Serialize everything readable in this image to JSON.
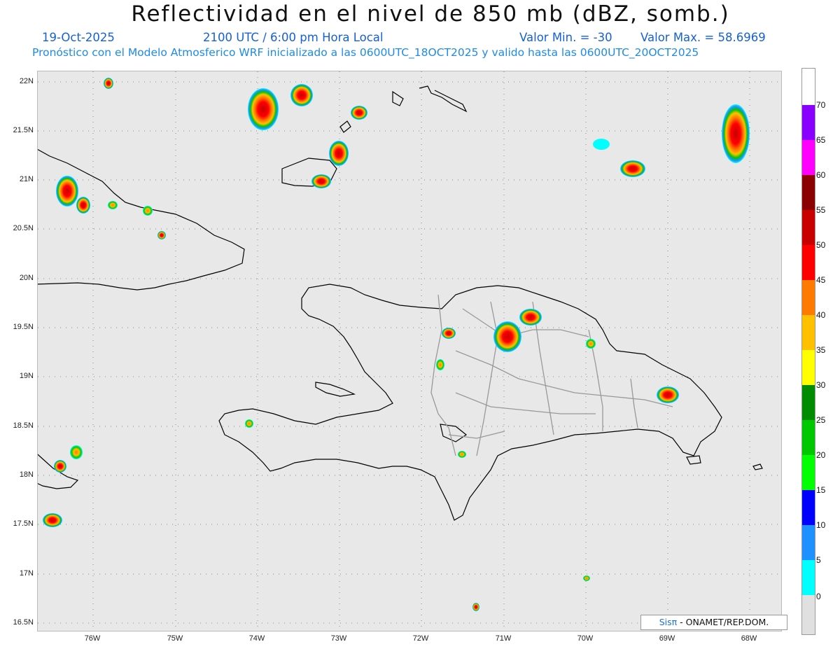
{
  "header": {
    "title": "Reflectividad en el nivel de 850 mb (dBZ, somb.)",
    "date": "19-Oct-2025",
    "time": "2100 UTC / 6:00 pm Hora Local",
    "valmin": "Valor Min. = -30",
    "valmax": "Valor Max. = 58.6969",
    "model_line": "Pronóstico con el Modelo Atmosferico WRF inicializado a las 0600UTC_18OCT2025 y valido hasta las  0600UTC_20OCT2025"
  },
  "axes": {
    "y_labels": [
      "22N",
      "21.5N",
      "21N",
      "20.5N",
      "20N",
      "19.5N",
      "19N",
      "18.5N",
      "18N",
      "17.5N",
      "17N",
      "16.5N"
    ],
    "x_labels": [
      "76W",
      "75W",
      "74W",
      "73W",
      "72W",
      "71W",
      "70W",
      "69W",
      "68W"
    ]
  },
  "colorbar": {
    "labels": [
      "70",
      "65",
      "60",
      "55",
      "50",
      "45",
      "40",
      "35",
      "30",
      "25",
      "20",
      "15",
      "10",
      "5",
      "0"
    ],
    "colors": [
      "#ffffff",
      "#8a00ff",
      "#ff00ff",
      "#8b0000",
      "#c80000",
      "#ff0000",
      "#ff7a00",
      "#ffc000",
      "#ffff00",
      "#008c00",
      "#00c800",
      "#00ff00",
      "#0000ff",
      "#1e90ff",
      "#00ffff",
      "#e0e0e0"
    ]
  },
  "credit": {
    "sis": "Sisπ",
    "rest": " - ONAMET/REP.DOM."
  }
}
